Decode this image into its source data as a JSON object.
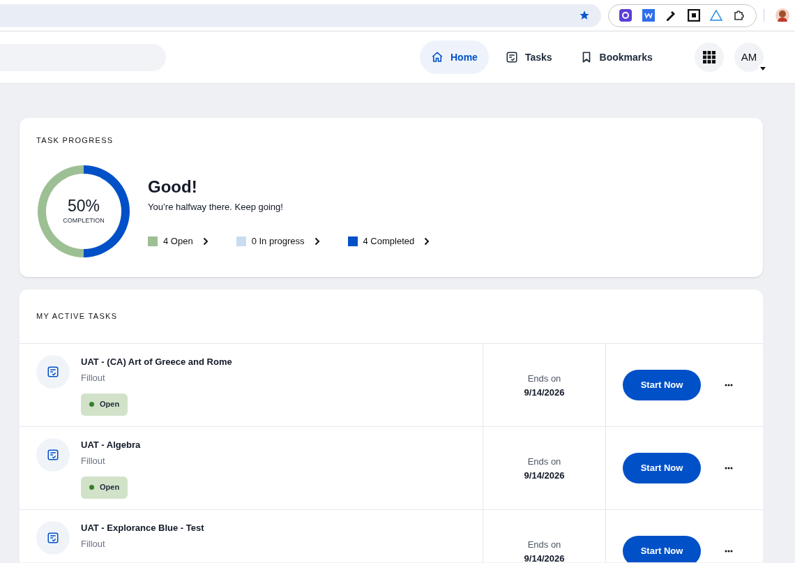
{
  "nav": {
    "items": [
      {
        "label": "Home",
        "selected": true
      },
      {
        "label": "Tasks",
        "selected": false
      },
      {
        "label": "Bookmarks",
        "selected": false
      }
    ],
    "user_initials": "AM"
  },
  "task_progress": {
    "title": "TASK PROGRESS",
    "percent": "50%",
    "percent_caption": "COMPLETION",
    "heading": "Good!",
    "message": "You’re halfway there. Keep going!",
    "level": 0.5,
    "legend": [
      {
        "label": "4 Open",
        "color": "#9dbf94"
      },
      {
        "label": "0 In progress",
        "color": "#c9dcf2"
      },
      {
        "label": "4 Completed",
        "color": "#0050c8"
      }
    ]
  },
  "active_tasks": {
    "title": "MY ACTIVE TASKS",
    "rows": [
      {
        "name": "UAT - (CA) Art of Greece and Rome",
        "type": "Fillout",
        "status": "Open",
        "ends_label": "Ends on",
        "ends_date": "9/14/2026",
        "action": "Start Now"
      },
      {
        "name": "UAT - Algebra",
        "type": "Fillout",
        "status": "Open",
        "ends_label": "Ends on",
        "ends_date": "9/14/2026",
        "action": "Start Now"
      },
      {
        "name": "UAT - Explorance Blue - Test",
        "type": "Fillout",
        "ends_label": "Ends on",
        "ends_date": "9/14/2026",
        "action": "Start Now"
      }
    ]
  }
}
